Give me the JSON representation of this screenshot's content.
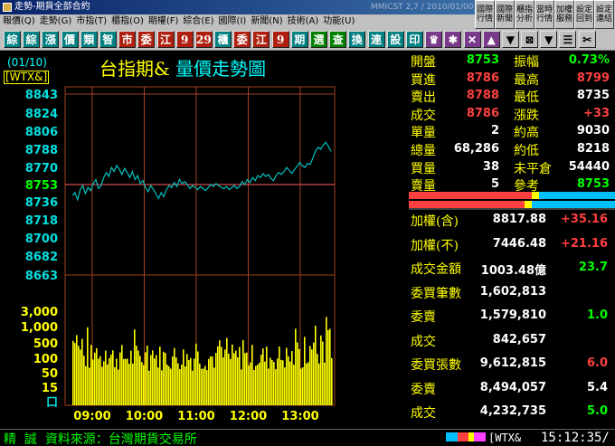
{
  "window": {
    "title": "走勢-期貨全部合約",
    "subtitle": "MMICST 2,7 / 2010/01/00"
  },
  "menu": [
    "報價(Q)",
    "走勢(G)",
    "市指(T)",
    "櫃指(O)",
    "期權(F)",
    "綜合(E)",
    "國際(I)",
    "新聞(N)",
    "技術(A)",
    "功能(U)"
  ],
  "top_buttons": [
    "國際行情",
    "國際新聞",
    "櫃指分析",
    "當時行情",
    "加權服務",
    "設定回到",
    "設定連結"
  ],
  "toolbar": [
    "綜",
    "綜",
    "漲",
    "價",
    "類",
    "智",
    "市",
    "委",
    "江",
    "9",
    "29",
    "櫃",
    "委",
    "江",
    "9",
    "期",
    "選",
    "查",
    "換",
    "連",
    "設",
    "印",
    "♛",
    "✱",
    "✕",
    "▲",
    "▼",
    "⊠",
    "▼",
    "☰",
    "✂"
  ],
  "chart": {
    "date": "(01/10)",
    "code": "[WTX&]",
    "title_a": "台指期&",
    "title_b": "量價走勢圖",
    "time_labels": [
      "09:00",
      "10:00",
      "11:00",
      "12:00",
      "13:00"
    ],
    "vol_labels": [
      "3,000",
      "1,000",
      "500",
      "100",
      "50",
      "15",
      "口"
    ],
    "colors": {
      "price_line": "#00c0c0",
      "volume": "#ffff00",
      "ref_line": "#ff6060",
      "grid": "#a04020"
    }
  },
  "chart_data": {
    "type": "line",
    "title": "台指期& 量價走勢圖",
    "price_axis": {
      "ticks": [
        8843,
        8824,
        8806,
        8788,
        8770,
        8753,
        8736,
        8718,
        8700,
        8682,
        8663
      ],
      "reference": 8753
    },
    "x_ticks": [
      "09:00",
      "10:00",
      "11:00",
      "12:00",
      "13:00"
    ],
    "series": [
      {
        "values": [
          8742,
          8745,
          8738,
          8748,
          8752,
          8744,
          8750,
          8747,
          8754,
          8758,
          8749,
          8752,
          8760,
          8765,
          8761,
          8770,
          8766,
          8772,
          8768,
          8763,
          8769,
          8765,
          8760,
          8766,
          8758,
          8762,
          8754,
          8757,
          8750,
          8746,
          8752,
          8748,
          8744,
          8739,
          8745,
          8741,
          8748,
          8752,
          8750,
          8755,
          8751,
          8758,
          8754,
          8756,
          8753,
          8749,
          8752,
          8750,
          8748,
          8751,
          8749,
          8747,
          8750,
          8753,
          8751,
          8754,
          8752,
          8750,
          8749,
          8751,
          8748,
          8750,
          8752,
          8749,
          8751,
          8756,
          8753,
          8758,
          8755,
          8760,
          8757,
          8762,
          8760,
          8764,
          8761,
          8763,
          8759,
          8757,
          8762,
          8765,
          8763,
          8766,
          8770,
          8767,
          8764,
          8768,
          8771,
          8775,
          8772,
          8770,
          8774,
          8773,
          8779,
          8786,
          8790,
          8788,
          8792,
          8795,
          8791,
          8786
        ]
      }
    ],
    "volume_axis": {
      "ticks": [
        "3,000",
        "1,000",
        "500",
        "100",
        "50",
        "15"
      ],
      "scale": "log"
    }
  },
  "quote": [
    {
      "label": "開盤",
      "value": "8753",
      "color": "#00ff00",
      "label2": "振幅",
      "value2": "0.73%",
      "color2": "#00ff00"
    },
    {
      "label": "買進",
      "value": "8786",
      "color": "#ff4040",
      "label2": "最高",
      "value2": "8799",
      "color2": "#ff4040"
    },
    {
      "label": "賣出",
      "value": "8788",
      "color": "#ff4040",
      "label2": "最低",
      "value2": "8735",
      "color2": "#ffffff"
    },
    {
      "label": "成交",
      "value": "8786",
      "color": "#ff4040",
      "label2": "漲跌",
      "value2": "+33",
      "color2": "#ff4040"
    },
    {
      "label": "單量",
      "value": "2",
      "color": "#ffffff",
      "label2": "約高",
      "value2": "9030",
      "color2": "#ffffff"
    },
    {
      "label": "總量",
      "value": "68,286",
      "color": "#ffffff",
      "label2": "約低",
      "value2": "8218",
      "color2": "#ffffff"
    },
    {
      "label": "買量",
      "value": "38",
      "color": "#ffffff",
      "label2": "未平倉",
      "value2": "54440",
      "color2": "#ffffff"
    },
    {
      "label": "賣量",
      "value": "5",
      "color": "#ffffff",
      "label2": "參考",
      "value2": "8753",
      "color2": "#00ff00"
    }
  ],
  "stats": [
    {
      "label": "加權(含)",
      "value": "8817.88",
      "change": "+35.16",
      "color": "#ff4040"
    },
    {
      "label": "加權(不)",
      "value": "7446.48",
      "change": "+21.16",
      "color": "#ff4040"
    },
    {
      "label": "成交金額",
      "value": "1003.48億",
      "change": "23.7",
      "color": "#00ff00"
    },
    {
      "label": "委買筆數",
      "value": "1,602,813",
      "change": "",
      "color": "#ffffff"
    },
    {
      "label": "委賣",
      "value": "1,579,810",
      "change": "1.0",
      "color": "#00ff00"
    },
    {
      "label": "成交",
      "value": "842,657",
      "change": "",
      "color": "#ffffff"
    },
    {
      "label": "委買張數",
      "value": "9,612,815",
      "change": "6.0",
      "color": "#ff4040"
    },
    {
      "label": "委賣",
      "value": "8,494,057",
      "change": "5.4",
      "color": "#ffffff"
    },
    {
      "label": "成交",
      "value": "4,232,735",
      "change": "5.0",
      "color": "#00ff00"
    }
  ],
  "status": {
    "left_a": "精",
    "left_b": "誠",
    "source": "資料來源：台灣期貨交易所",
    "code": "[WTX&",
    "time": "15:12:35/"
  }
}
